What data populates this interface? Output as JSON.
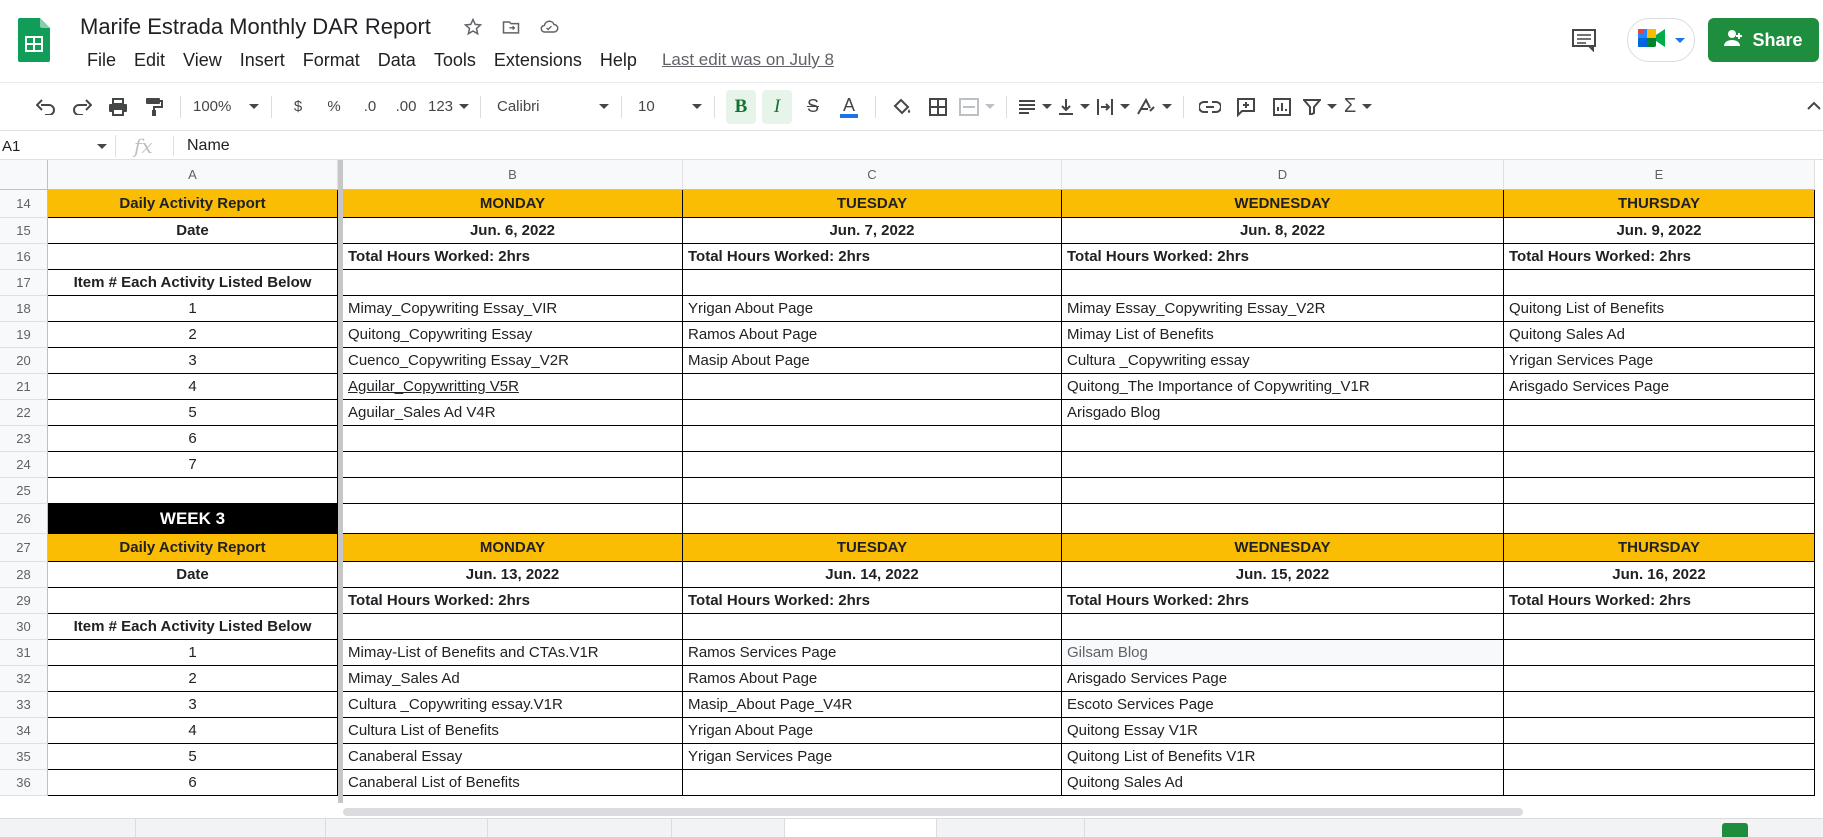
{
  "app": {
    "doc_title": "Marife Estrada Monthly DAR Report",
    "last_edit": "Last edit was on July 8",
    "share_label": "Share",
    "accent": "#1e8e3e"
  },
  "menu": [
    "File",
    "Edit",
    "View",
    "Insert",
    "Format",
    "Data",
    "Tools",
    "Extensions",
    "Help"
  ],
  "toolbar": {
    "zoom": "100%",
    "currency": "$",
    "percent": "%",
    "dec_dec": ".0",
    "inc_dec": ".00",
    "num_format": "123",
    "font": "Calibri",
    "font_size": "10"
  },
  "formula_bar": {
    "cell_ref": "A1",
    "fx": "fx",
    "content": "Name"
  },
  "columns": [
    "A",
    "B",
    "C",
    "D",
    "E"
  ],
  "rows": [
    {
      "num": "14",
      "cells": [
        "Daily Activity Report",
        "MONDAY",
        "TUESDAY",
        "WEDNESDAY",
        "THURSDAY"
      ]
    },
    {
      "num": "15",
      "cells": [
        "Date",
        "Jun. 6, 2022",
        "Jun. 7, 2022",
        "Jun. 8, 2022",
        "Jun. 9, 2022"
      ]
    },
    {
      "num": "16",
      "cells": [
        "",
        "Total Hours Worked: 2hrs",
        "Total Hours Worked: 2hrs",
        "Total Hours Worked: 2hrs",
        "Total Hours Worked: 2hrs"
      ]
    },
    {
      "num": "17",
      "cells": [
        "Item # Each Activity Listed Below",
        "",
        "",
        "",
        ""
      ]
    },
    {
      "num": "18",
      "cells": [
        "1",
        "Mimay_Copywriting Essay_VIR",
        "Yrigan About Page",
        "Mimay Essay_Copywriting Essay_V2R",
        "Quitong List of Benefits"
      ]
    },
    {
      "num": "19",
      "cells": [
        "2",
        "Quitong_Copywriting Essay",
        "Ramos About Page",
        "Mimay List of Benefits",
        "Quitong Sales Ad"
      ]
    },
    {
      "num": "20",
      "cells": [
        "3",
        "Cuenco_Copywriting Essay_V2R",
        "Masip About Page",
        "Cultura _Copywriting essay",
        "Yrigan Services Page"
      ]
    },
    {
      "num": "21",
      "cells": [
        "4",
        "Aguilar_Copywritting V5R",
        "",
        "Quitong_The Importance of Copywriting_V1R",
        "Arisgado Services Page"
      ]
    },
    {
      "num": "22",
      "cells": [
        "5",
        " Aguilar_Sales Ad V4R",
        "",
        "Arisgado Blog",
        ""
      ]
    },
    {
      "num": "23",
      "cells": [
        "6",
        "",
        "",
        "",
        ""
      ]
    },
    {
      "num": "24",
      "cells": [
        "7",
        "",
        "",
        "",
        ""
      ]
    },
    {
      "num": "25",
      "cells": [
        "",
        "",
        "",
        "",
        ""
      ]
    },
    {
      "num": "26",
      "cells": [
        "WEEK 3",
        "",
        "",
        "",
        ""
      ]
    },
    {
      "num": "27",
      "cells": [
        "Daily Activity Report",
        "MONDAY",
        "TUESDAY",
        "WEDNESDAY",
        "THURSDAY"
      ]
    },
    {
      "num": "28",
      "cells": [
        "Date",
        "Jun. 13, 2022",
        "Jun. 14, 2022",
        "Jun. 15, 2022",
        "Jun. 16, 2022"
      ]
    },
    {
      "num": "29",
      "cells": [
        "",
        "Total Hours Worked: 2hrs",
        "Total Hours Worked: 2hrs",
        "Total Hours Worked: 2hrs",
        "Total Hours Worked: 2hrs"
      ]
    },
    {
      "num": "30",
      "cells": [
        "Item # Each Activity Listed Below",
        "",
        "",
        "",
        ""
      ]
    },
    {
      "num": "31",
      "cells": [
        "1",
        "Mimay-List of Benefits and CTAs.V1R",
        "Ramos Services Page",
        "Gilsam Blog",
        ""
      ]
    },
    {
      "num": "32",
      "cells": [
        "2",
        "Mimay_Sales Ad",
        "Ramos About Page",
        "Arisgado Services Page",
        ""
      ]
    },
    {
      "num": "33",
      "cells": [
        "3",
        "Cultura _Copywriting essay.V1R",
        "Masip_About Page_V4R",
        "Escoto Services Page",
        ""
      ]
    },
    {
      "num": "34",
      "cells": [
        "4",
        "Cultura List of Benefits",
        "Yrigan About Page",
        "Quitong Essay V1R",
        ""
      ]
    },
    {
      "num": "35",
      "cells": [
        "5",
        "Canaberal Essay",
        "Yrigan Services Page",
        "Quitong List of Benefits V1R",
        ""
      ]
    },
    {
      "num": "36",
      "cells": [
        "6",
        "Canaberal List of Benefits",
        "",
        "Quitong Sales Ad",
        ""
      ]
    }
  ]
}
